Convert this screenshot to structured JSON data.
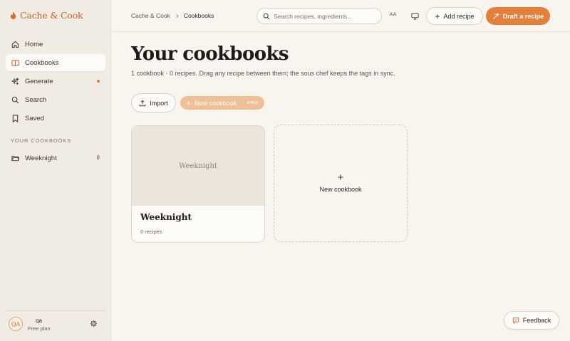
{
  "brand": {
    "name": "Cache & Cook",
    "icon": "flame-icon",
    "color": "#c8612a"
  },
  "sidebar": {
    "items": [
      {
        "label": "Home",
        "icon": "home-icon"
      },
      {
        "label": "Cookbooks",
        "icon": "book-icon",
        "active": true
      },
      {
        "label": "Generate",
        "icon": "sparkle-icon",
        "badge_dot": true
      },
      {
        "label": "Search",
        "icon": "search-icon"
      },
      {
        "label": "Saved",
        "icon": "bookmark-icon"
      }
    ],
    "section_title": "YOUR COOKBOOKS",
    "cookbooks": [
      {
        "label": "Weeknight",
        "count": "0",
        "icon": "folder-icon"
      }
    ],
    "user": {
      "initials": "QA",
      "name": "qa",
      "plan": "Free plan"
    }
  },
  "topbar": {
    "breadcrumb": [
      "Cache & Cook",
      "Cookbooks"
    ],
    "search_placeholder": "Search recipes, ingredients...",
    "aa_label": "AA",
    "add_recipe_label": "Add recipe",
    "draft_label": "Draft a recipe"
  },
  "main": {
    "title": "Your cookbooks",
    "subtitle": "1 cookbook · 0 recipes. Drag any recipe between them; the sous chef keeps the tags in sync.",
    "import_label": "Import",
    "new_cookbook_label": "New cookbook",
    "pro_badge": "PRO",
    "cards": [
      {
        "cover_text": "Weeknight",
        "title": "Weeknight",
        "count": "0 recipes"
      }
    ],
    "new_card_label": "New cookbook"
  },
  "feedback_label": "Feedback",
  "colors": {
    "accent": "#e3803a",
    "accent_muted": "#efbf95",
    "background": "#f8f5ef",
    "sidebar": "#f1ece3"
  }
}
